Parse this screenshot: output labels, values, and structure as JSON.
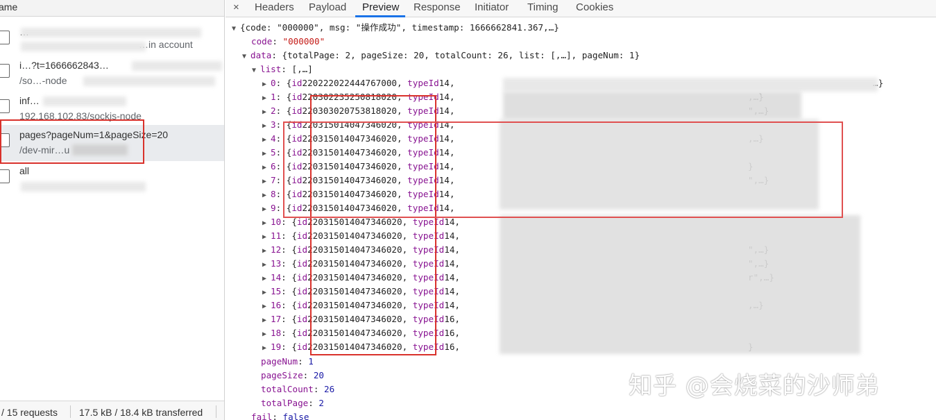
{
  "left_panel": {
    "header": "ame",
    "requests": [
      {
        "line1": "…",
        "line2": "…in account",
        "selected": false
      },
      {
        "line1": "i…?t=1666662843…",
        "line2": "/so…-node",
        "selected": false
      },
      {
        "line1": "inf…",
        "line2": "192.168.102.83/sockjs-node",
        "selected": false
      },
      {
        "line1": "pages?pageNum=1&pageSize=20",
        "line2": "/dev-mir…u",
        "selected": true
      },
      {
        "line1": "all",
        "line2": "",
        "selected": false
      }
    ],
    "footer": {
      "requests": "/ 15 requests",
      "transferred": "17.5 kB / 18.4 kB transferred"
    }
  },
  "tabs": {
    "close": "×",
    "items": [
      "Headers",
      "Payload",
      "Preview",
      "Response",
      "Initiator",
      "Timing",
      "Cookies"
    ],
    "active": "Preview"
  },
  "preview": {
    "root_summary": "{code: \"000000\", msg: \"操作成功\", timestamp: 1666662841.367,…}",
    "code_key": "code",
    "code_value": "\"000000\"",
    "data_key": "data",
    "data_summary": "{totalPage: 2, pageSize: 20, totalCount: 26, list: [,…], pageNum: 1}",
    "list_key": "list",
    "list_summary": "[,…]",
    "list_items": [
      {
        "index": "0",
        "id": "220222022444767000",
        "typeId": "14",
        "tail": "…}"
      },
      {
        "index": "1",
        "id": "220302235250818020",
        "typeId": "14",
        "tail": ",…}"
      },
      {
        "index": "2",
        "id": "220303020753818020",
        "typeId": "14",
        "tail": "\",…}"
      },
      {
        "index": "3",
        "id": "220315014047346020",
        "typeId": "14",
        "tail": ""
      },
      {
        "index": "4",
        "id": "220315014047346020",
        "typeId": "14",
        "tail": ",…}"
      },
      {
        "index": "5",
        "id": "220315014047346020",
        "typeId": "14",
        "tail": ""
      },
      {
        "index": "6",
        "id": "220315014047346020",
        "typeId": "14",
        "tail": "}"
      },
      {
        "index": "7",
        "id": "220315014047346020",
        "typeId": "14",
        "tail": "\",…}"
      },
      {
        "index": "8",
        "id": "220315014047346020",
        "typeId": "14",
        "tail": ""
      },
      {
        "index": "9",
        "id": "220315014047346020",
        "typeId": "14",
        "tail": ""
      },
      {
        "index": "10",
        "id": "220315014047346020",
        "typeId": "14",
        "tail": ""
      },
      {
        "index": "11",
        "id": "220315014047346020",
        "typeId": "14",
        "tail": ""
      },
      {
        "index": "12",
        "id": "220315014047346020",
        "typeId": "14",
        "tail": "\",…}"
      },
      {
        "index": "13",
        "id": "220315014047346020",
        "typeId": "14",
        "tail": "\",…}"
      },
      {
        "index": "14",
        "id": "220315014047346020",
        "typeId": "14",
        "tail": "r\",…}"
      },
      {
        "index": "15",
        "id": "220315014047346020",
        "typeId": "14",
        "tail": ""
      },
      {
        "index": "16",
        "id": "220315014047346020",
        "typeId": "14",
        "tail": ",…}"
      },
      {
        "index": "17",
        "id": "220315014047346020",
        "typeId": "16",
        "tail": ""
      },
      {
        "index": "18",
        "id": "220315014047346020",
        "typeId": "16",
        "tail": ""
      },
      {
        "index": "19",
        "id": "220315014047346020",
        "typeId": "16",
        "tail": "}"
      }
    ],
    "pageNum_key": "pageNum",
    "pageNum_value": "1",
    "pageSize_key": "pageSize",
    "pageSize_value": "20",
    "totalCount_key": "totalCount",
    "totalCount_value": "26",
    "totalPage_key": "totalPage",
    "totalPage_value": "2",
    "fail_key": "fail",
    "fail_value": "false"
  },
  "watermark": "知乎 @会烧菜的沙师弟",
  "colors": {
    "annotation_red": "#d9312b",
    "key_purple": "#881391",
    "string_red": "#c41a16",
    "number_blue": "#1a1aa6",
    "tab_active_blue": "#1a73e8"
  }
}
